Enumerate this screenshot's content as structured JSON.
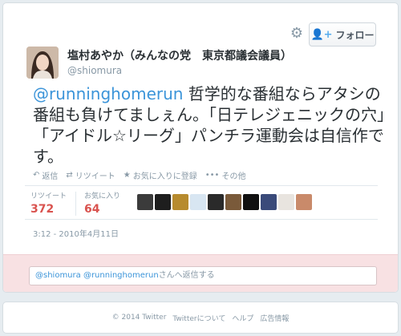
{
  "header": {
    "follow_label": "フォロー"
  },
  "profile": {
    "name": "塩村あやか（みんなの党　東京都議会議員）",
    "handle": "@shiomura"
  },
  "tweet": {
    "mention": "@runninghomerun",
    "text": " 哲学的な番組ならアタシの番組も負けてましぇん。「日テレジェニックの穴」「アイドル☆リーグ」パンチラ運動会は自信作です。"
  },
  "actions": {
    "reply": "返信",
    "retweet": "リツイート",
    "favorite": "お気に入りに登録",
    "more": "その他"
  },
  "stats": {
    "retweets_label": "リツイート",
    "retweets_count": "372",
    "favorites_label": "お気に入り",
    "favorites_count": "64"
  },
  "favoriters": [
    {
      "name": "avatar-1",
      "color": "#3b3b3b"
    },
    {
      "name": "avatar-2",
      "color": "#1e1e1e"
    },
    {
      "name": "avatar-3",
      "color": "#b78b2e"
    },
    {
      "name": "avatar-4",
      "color": "#d8e6f2"
    },
    {
      "name": "avatar-5",
      "color": "#2a2a2a"
    },
    {
      "name": "avatar-6",
      "color": "#7a5a3a"
    },
    {
      "name": "avatar-7",
      "color": "#111111"
    },
    {
      "name": "avatar-8",
      "color": "#3a4a7a"
    },
    {
      "name": "avatar-9",
      "color": "#e8e4df"
    },
    {
      "name": "avatar-10",
      "color": "#c98a6a"
    }
  ],
  "timestamp": "3:12 - 2010年4月11日",
  "reply": {
    "prefill_mentions": "@shiomura @runninghomerun",
    "prefill_suffix": "さんへ返信する"
  },
  "footer": {
    "copyright": "© 2014 Twitter",
    "about": "Twitterについて",
    "help": "ヘルプ",
    "ads": "広告情報"
  }
}
